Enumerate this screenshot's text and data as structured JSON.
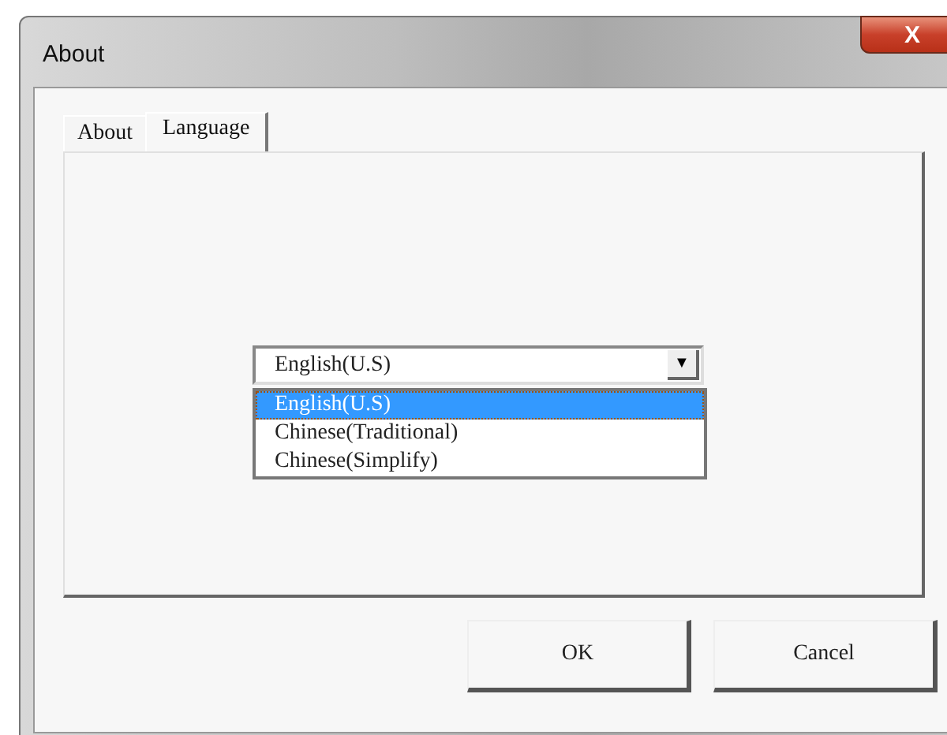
{
  "window": {
    "title": "About",
    "close": "X"
  },
  "tabs": [
    {
      "label": "About",
      "selected": false
    },
    {
      "label": "Language",
      "selected": true
    }
  ],
  "language_combo": {
    "value": "English(U.S)",
    "arrow": "▼",
    "options": [
      {
        "label": "English(U.S)",
        "selected": true
      },
      {
        "label": "Chinese(Traditional)",
        "selected": false
      },
      {
        "label": "Chinese(Simplify)",
        "selected": false
      }
    ]
  },
  "buttons": [
    "OK",
    "Cancel"
  ]
}
